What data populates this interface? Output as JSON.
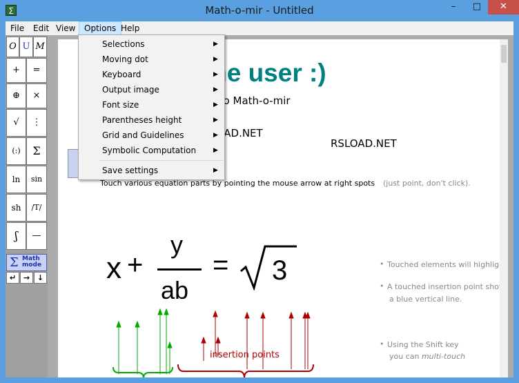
{
  "window": {
    "title": "Math-o-mir - Untitled",
    "app_icon": "Σ",
    "min_glyph": "–",
    "max_glyph": "□",
    "close_glyph": "✕"
  },
  "menubar": {
    "items": [
      "File",
      "Edit",
      "View",
      "Options",
      "Help"
    ],
    "active": "Options"
  },
  "options_menu": {
    "items": [
      {
        "label": "Selections"
      },
      {
        "label": "Moving dot"
      },
      {
        "label": "Keyboard"
      },
      {
        "label": "Output image"
      },
      {
        "label": "Font size"
      },
      {
        "label": "Parentheses height"
      },
      {
        "label": "Grid and Guidelines"
      },
      {
        "label": "Symbolic Computation"
      },
      {
        "label": "Save settings"
      }
    ],
    "submenu_glyph": "▶"
  },
  "toolbox": {
    "font_buttons": [
      "O",
      "U",
      "M"
    ],
    "tools": [
      "+",
      "=",
      "⊕",
      "×",
      "√",
      "⋮",
      "(:)",
      "Σ",
      "ln",
      "sin",
      "sh",
      "/T/",
      "ʃ",
      "—"
    ],
    "math_mode_sigma": "Σ",
    "math_mode_label_1": "Math",
    "math_mode_label_2": "mode",
    "arrows": [
      "↵",
      "→",
      "↓"
    ]
  },
  "document": {
    "heading": "st-time user :)",
    "subheading": "troduction to Math-o-mir",
    "rsload_left": "D.NET RSLOAD.NET",
    "rsload_right": "RSLOAD.NET",
    "touch_text": "Touch various equation parts by pointing the mouse arrow at right spots",
    "touch_hint": "(just point, don't click).",
    "eq_x": "x",
    "eq_plus": "+",
    "eq_y": "y",
    "eq_ab": "ab",
    "eq_equals": "=",
    "eq_3": "3",
    "insertion_label": "insertion points",
    "note1": "Touched elements will highlig",
    "note2_line1": "A touched insertion point shov",
    "note2_line2": "a blue vertical line.",
    "note3_line1": "Using the Shift key",
    "note3_line2_a": "you can ",
    "note3_line2_b": "multi-touch",
    "bullet": "•"
  },
  "colors": {
    "heading": "#008080",
    "red_marks": "#aa0000",
    "green_marks": "#00aa00",
    "note_gray": "#888888",
    "title_bar": "#5aa0e0",
    "close_button": "#c7504b"
  }
}
